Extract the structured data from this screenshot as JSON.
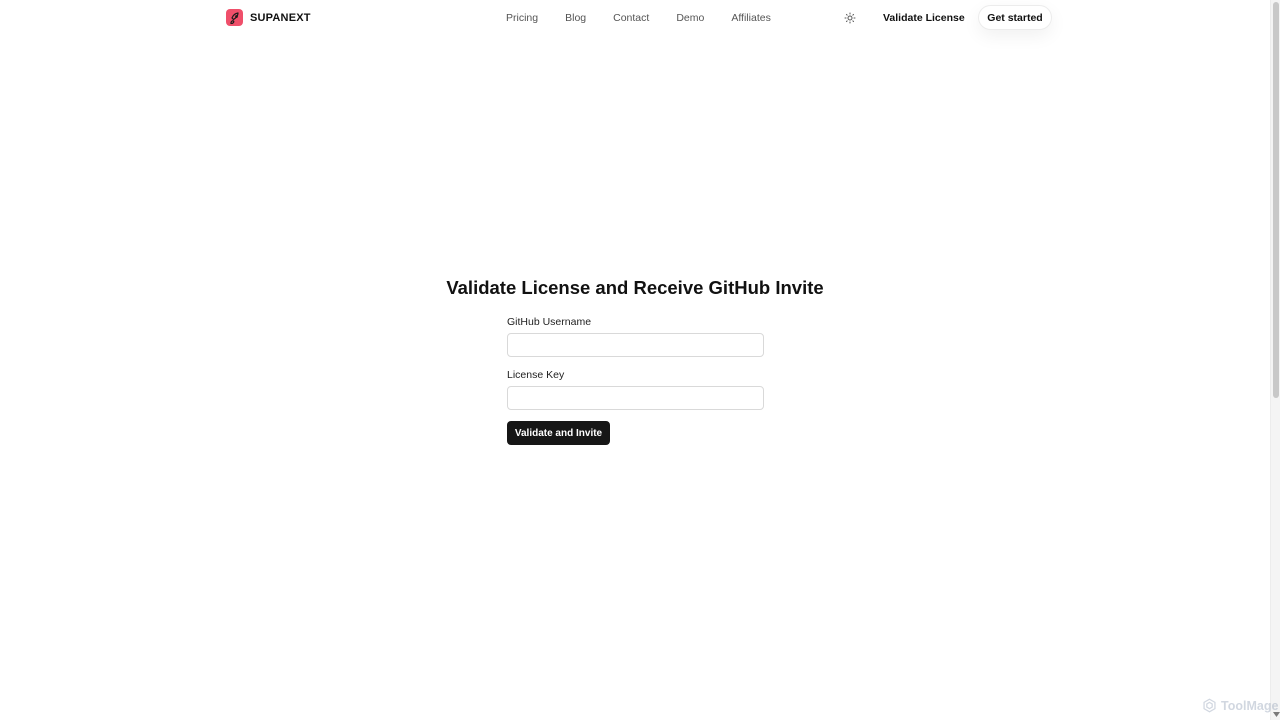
{
  "brand": {
    "name": "SUPANEXT",
    "logo_icon": "rocket-icon",
    "logo_color": "#ef4f6a"
  },
  "nav": {
    "items": [
      {
        "label": "Pricing"
      },
      {
        "label": "Blog"
      },
      {
        "label": "Contact"
      },
      {
        "label": "Demo"
      },
      {
        "label": "Affiliates"
      }
    ]
  },
  "header_actions": {
    "theme_icon": "sun-icon",
    "validate_license_label": "Validate License",
    "get_started_label": "Get started"
  },
  "main": {
    "title": "Validate License and Receive GitHub Invite",
    "form": {
      "github_username_label": "GitHub Username",
      "github_username_value": "",
      "license_key_label": "License Key",
      "license_key_value": "",
      "submit_label": "Validate and Invite"
    }
  },
  "watermark": {
    "text": "ToolMage"
  },
  "colors": {
    "primary_button": "#161616",
    "accent": "#ef4f6a"
  }
}
